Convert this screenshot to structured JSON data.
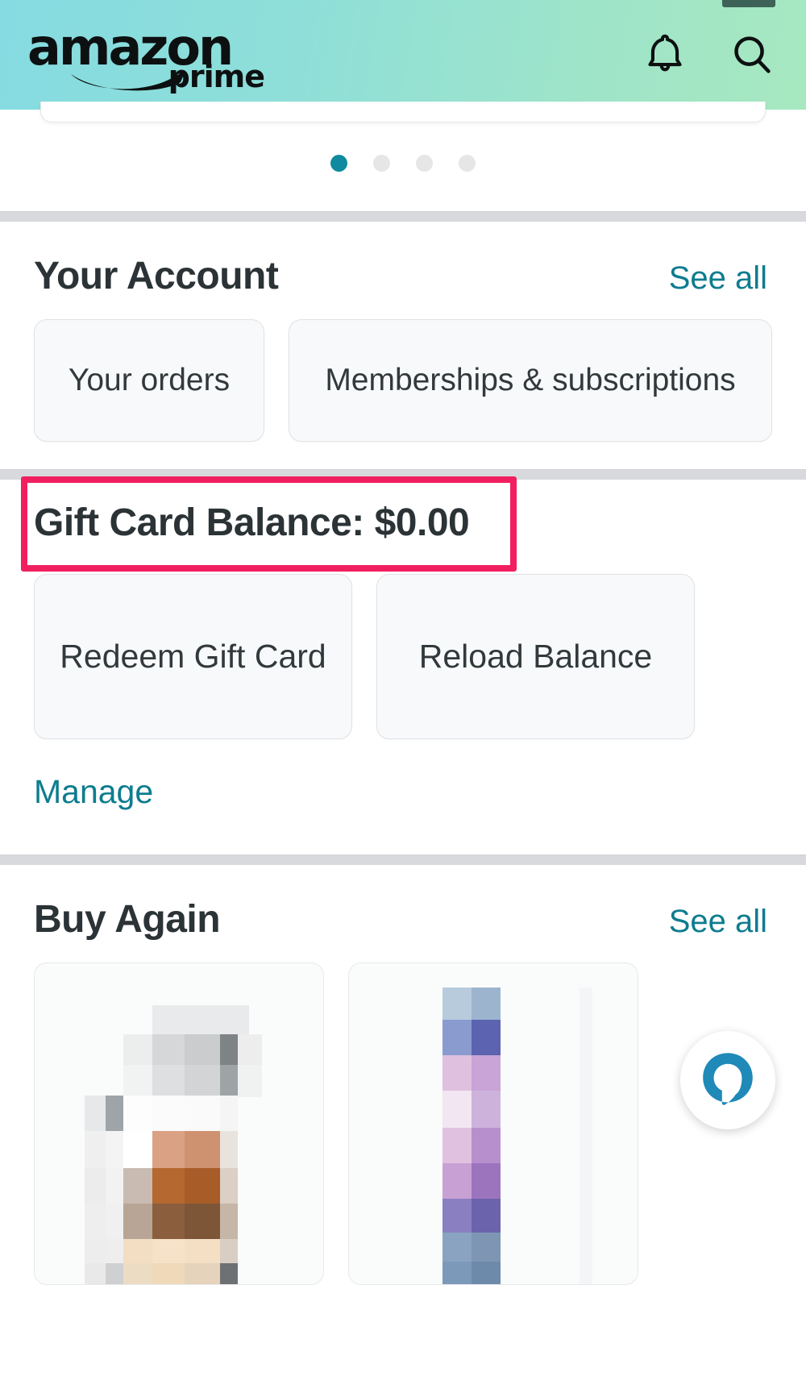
{
  "app": {
    "brand_primary": "amazon",
    "brand_secondary": "prime",
    "header_gradient_start": "#85dbe1",
    "header_gradient_end": "#a7e8c0",
    "accent_teal": "#0e7c8f",
    "highlight_color": "#f11f5f"
  },
  "header": {
    "notifications_icon": "bell-icon",
    "search_icon": "search-icon"
  },
  "carousel": {
    "dot_count": 4,
    "active_index": 0,
    "dots": [
      "1",
      "2",
      "3",
      "4"
    ]
  },
  "account_section": {
    "title": "Your Account",
    "see_all": "See all",
    "tiles": [
      {
        "label": "Your orders"
      },
      {
        "label": "Memberships & subscriptions"
      }
    ]
  },
  "gift_card_section": {
    "balance_label": "Gift Card Balance: $0.00",
    "highlighted": true,
    "tiles": [
      {
        "label": "Redeem Gift Card"
      },
      {
        "label": "Reload Balance"
      }
    ],
    "manage_link": "Manage"
  },
  "buy_again_section": {
    "title": "Buy Again",
    "see_all": "See all",
    "products": [
      {
        "name": "product-thumbnail-1"
      },
      {
        "name": "product-thumbnail-2"
      }
    ]
  },
  "assistant": {
    "icon": "alexa-bubble-icon",
    "color": "#1f89b8"
  }
}
